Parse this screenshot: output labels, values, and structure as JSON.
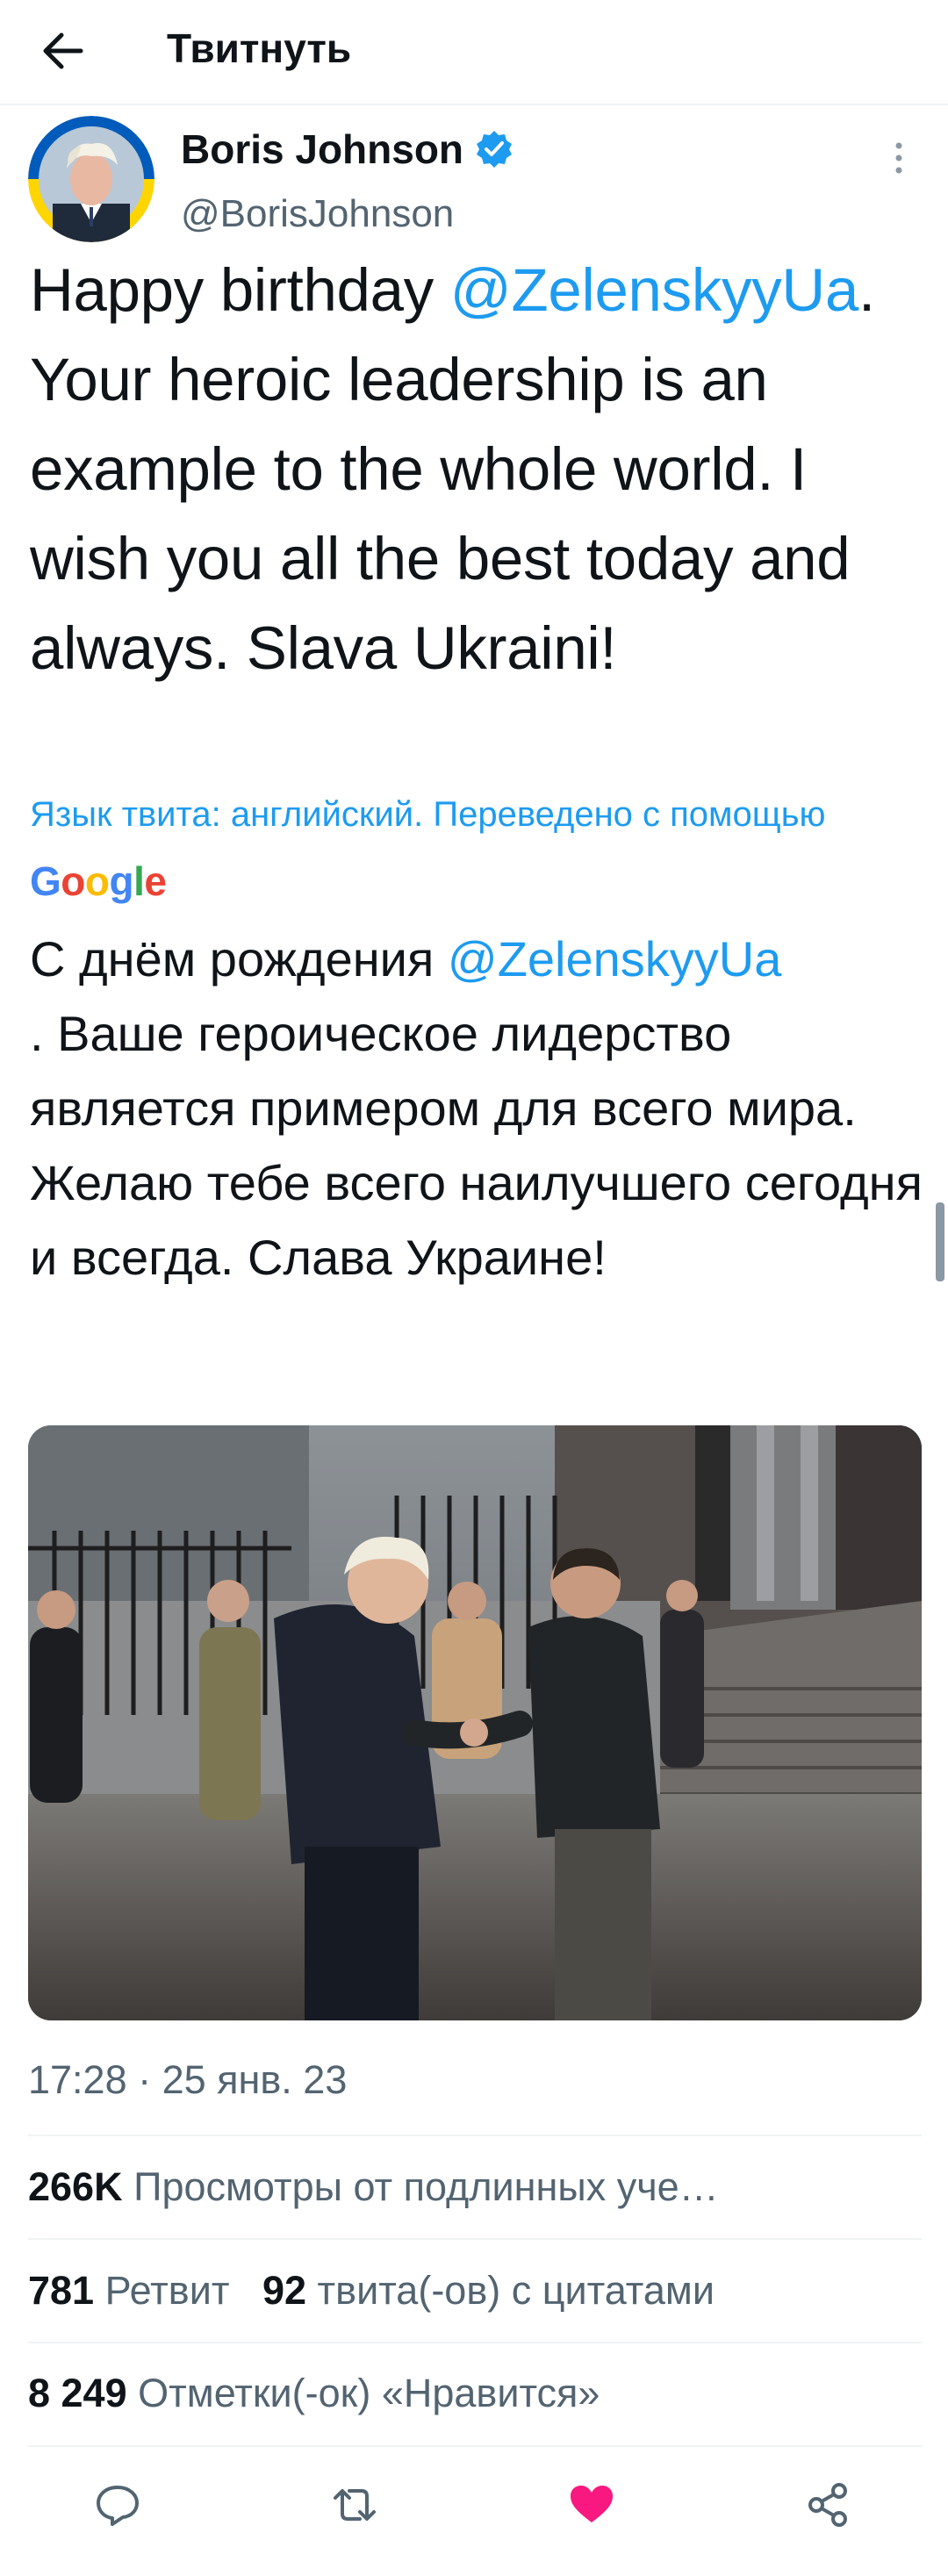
{
  "header": {
    "title": "Твитнуть",
    "back_icon": "arrow-left-icon"
  },
  "author": {
    "name": "Boris Johnson",
    "handle": "@BorisJohnson",
    "verified": true,
    "avatar_border_colors": [
      "#005bbb",
      "#ffd500"
    ]
  },
  "tweet": {
    "text_parts": [
      "Happy birthday ",
      "@ZelenskyyUa",
      ". Your heroic leadership is an example to the whole world. I wish you all the best today and always. Slava Ukraini!"
    ],
    "translation_note": "Язык твита: английский. Переведено с помощью",
    "translator": "Google",
    "translation_parts": [
      "С днём рождения ",
      "@ZelenskyyUa",
      ". Ваше героическое лидерство является примером для всего мира. Желаю тебе всего наилучшего сегодня и всегда. Слава Украине!"
    ],
    "timestamp": "17:28 · 25 янв. 23"
  },
  "stats": {
    "views_count": "266K",
    "views_label": "Просмотры от подлинных уче…",
    "retweets_count": "781",
    "retweets_label": "Ретвит",
    "quotes_count": "92",
    "quotes_label": "твита(-ов) с цитатами",
    "likes_count": "8 249",
    "likes_label": "Отметки(-ок) «Нравится»"
  },
  "actions": [
    {
      "name": "reply-icon",
      "color": "#536471"
    },
    {
      "name": "retweet-icon",
      "color": "#536471"
    },
    {
      "name": "like-icon",
      "color": "#f91880"
    },
    {
      "name": "share-icon",
      "color": "#536471"
    }
  ],
  "colors": {
    "accent": "#1d9bf0",
    "secondary_text": "#536471",
    "like": "#f91880"
  }
}
